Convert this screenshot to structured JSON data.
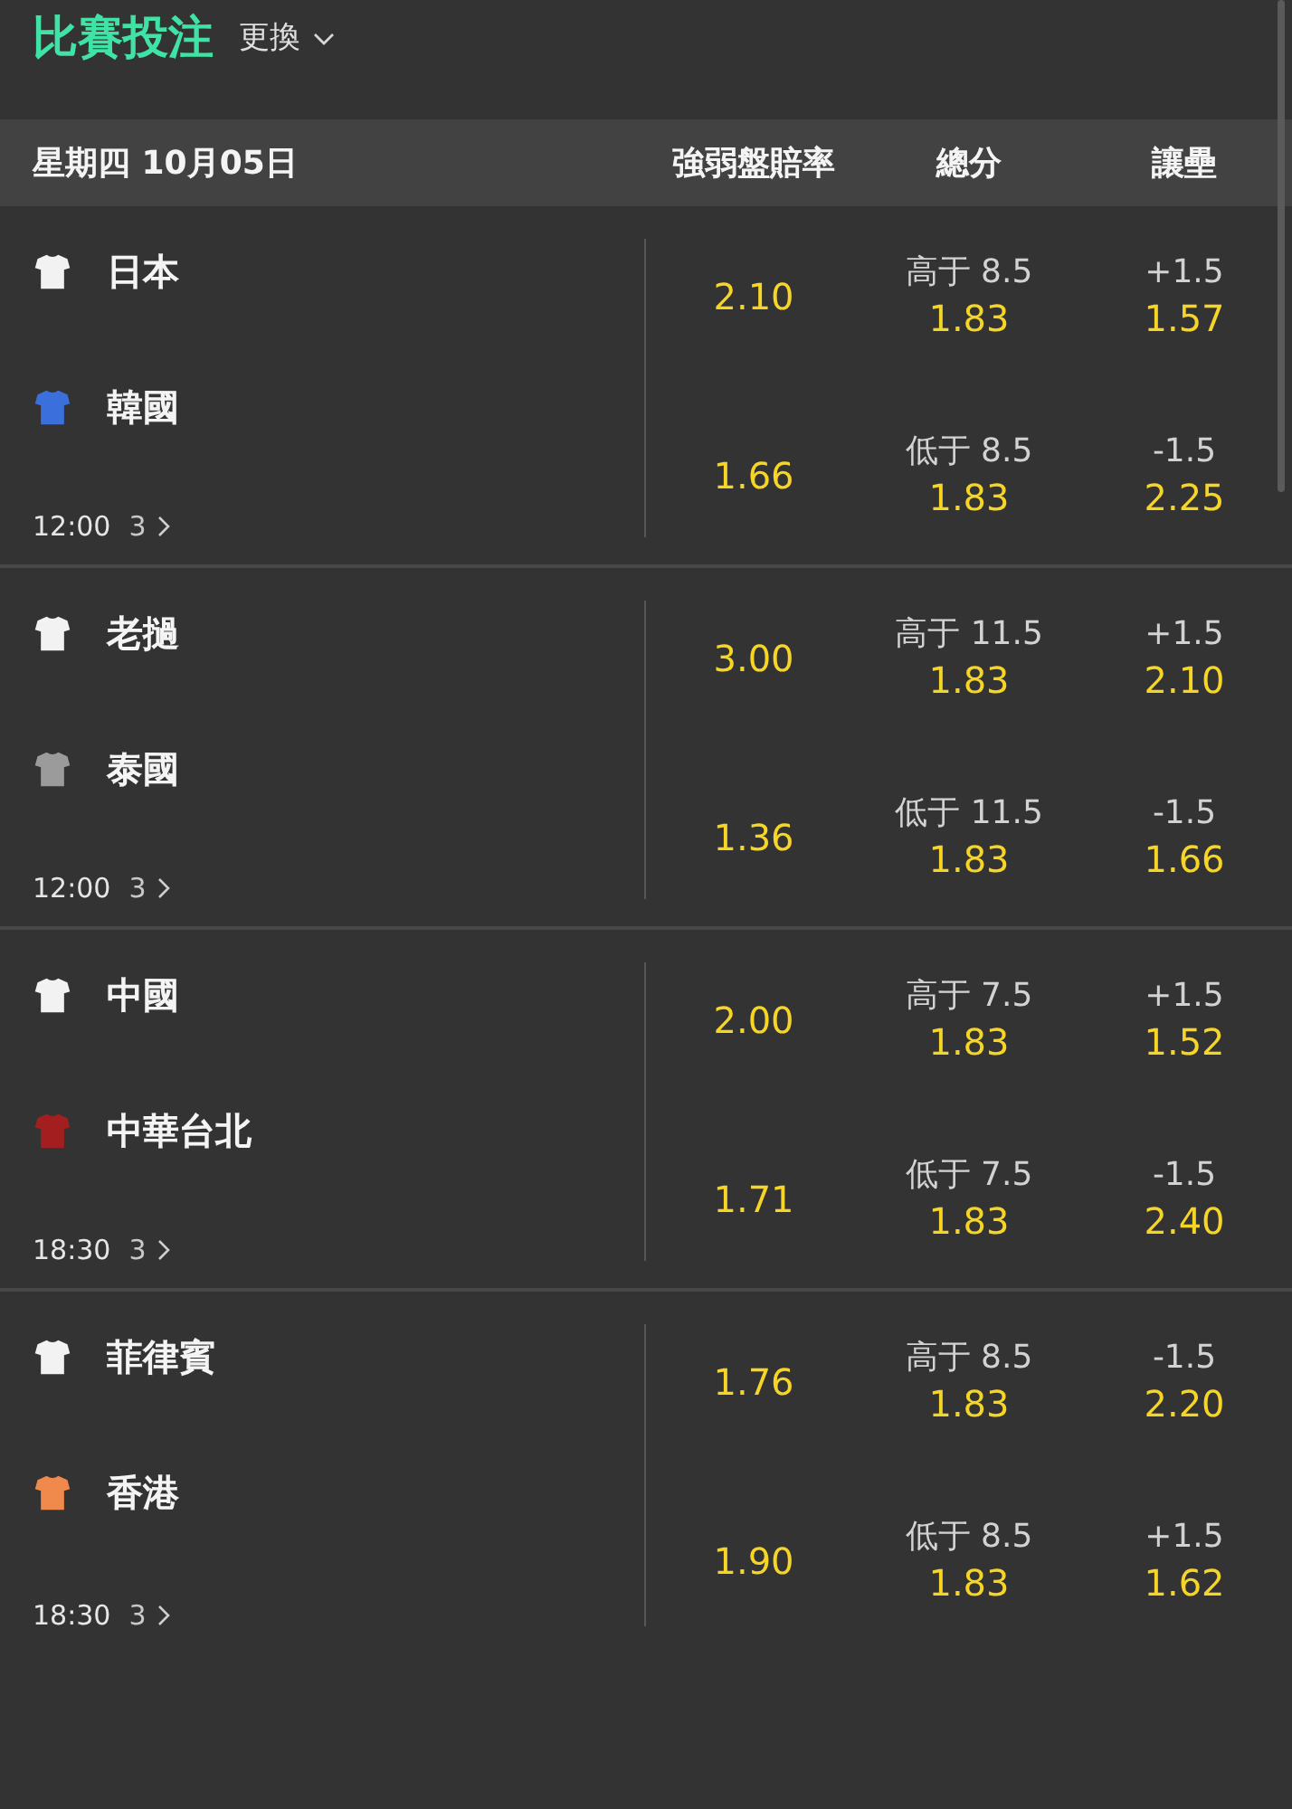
{
  "header": {
    "title": "比賽投注",
    "switch_label": "更換"
  },
  "table": {
    "date": "星期四 10月05日",
    "columns": [
      "強弱盤賠率",
      "總分",
      "讓壘"
    ]
  },
  "matches": [
    {
      "time": "12:00",
      "markets_count": "3",
      "teams": [
        {
          "name": "日本",
          "color": "#f2f2f2",
          "moneyline": "2.10",
          "total": {
            "label": "高于 8.5",
            "odds": "1.83"
          },
          "handicap": {
            "label": "+1.5",
            "odds": "1.57"
          }
        },
        {
          "name": "韓國",
          "color": "#3b6fdc",
          "moneyline": "1.66",
          "total": {
            "label": "低于 8.5",
            "odds": "1.83"
          },
          "handicap": {
            "label": "-1.5",
            "odds": "2.25"
          }
        }
      ]
    },
    {
      "time": "12:00",
      "markets_count": "3",
      "teams": [
        {
          "name": "老撾",
          "color": "#f2f2f2",
          "moneyline": "3.00",
          "total": {
            "label": "高于 11.5",
            "odds": "1.83"
          },
          "handicap": {
            "label": "+1.5",
            "odds": "2.10"
          }
        },
        {
          "name": "泰國",
          "color": "#9b9b9b",
          "moneyline": "1.36",
          "total": {
            "label": "低于 11.5",
            "odds": "1.83"
          },
          "handicap": {
            "label": "-1.5",
            "odds": "1.66"
          }
        }
      ]
    },
    {
      "time": "18:30",
      "markets_count": "3",
      "teams": [
        {
          "name": "中國",
          "color": "#f2f2f2",
          "moneyline": "2.00",
          "total": {
            "label": "高于 7.5",
            "odds": "1.83"
          },
          "handicap": {
            "label": "+1.5",
            "odds": "1.52"
          }
        },
        {
          "name": "中華台北",
          "color": "#a31f1f",
          "moneyline": "1.71",
          "total": {
            "label": "低于 7.5",
            "odds": "1.83"
          },
          "handicap": {
            "label": "-1.5",
            "odds": "2.40"
          }
        }
      ]
    },
    {
      "time": "18:30",
      "markets_count": "3",
      "teams": [
        {
          "name": "菲律賓",
          "color": "#f2f2f2",
          "moneyline": "1.76",
          "total": {
            "label": "高于 8.5",
            "odds": "1.83"
          },
          "handicap": {
            "label": "-1.5",
            "odds": "2.20"
          }
        },
        {
          "name": "香港",
          "color": "#ef8a4c",
          "moneyline": "1.90",
          "total": {
            "label": "低于 8.5",
            "odds": "1.83"
          },
          "handicap": {
            "label": "+1.5",
            "odds": "1.62"
          }
        }
      ]
    }
  ]
}
